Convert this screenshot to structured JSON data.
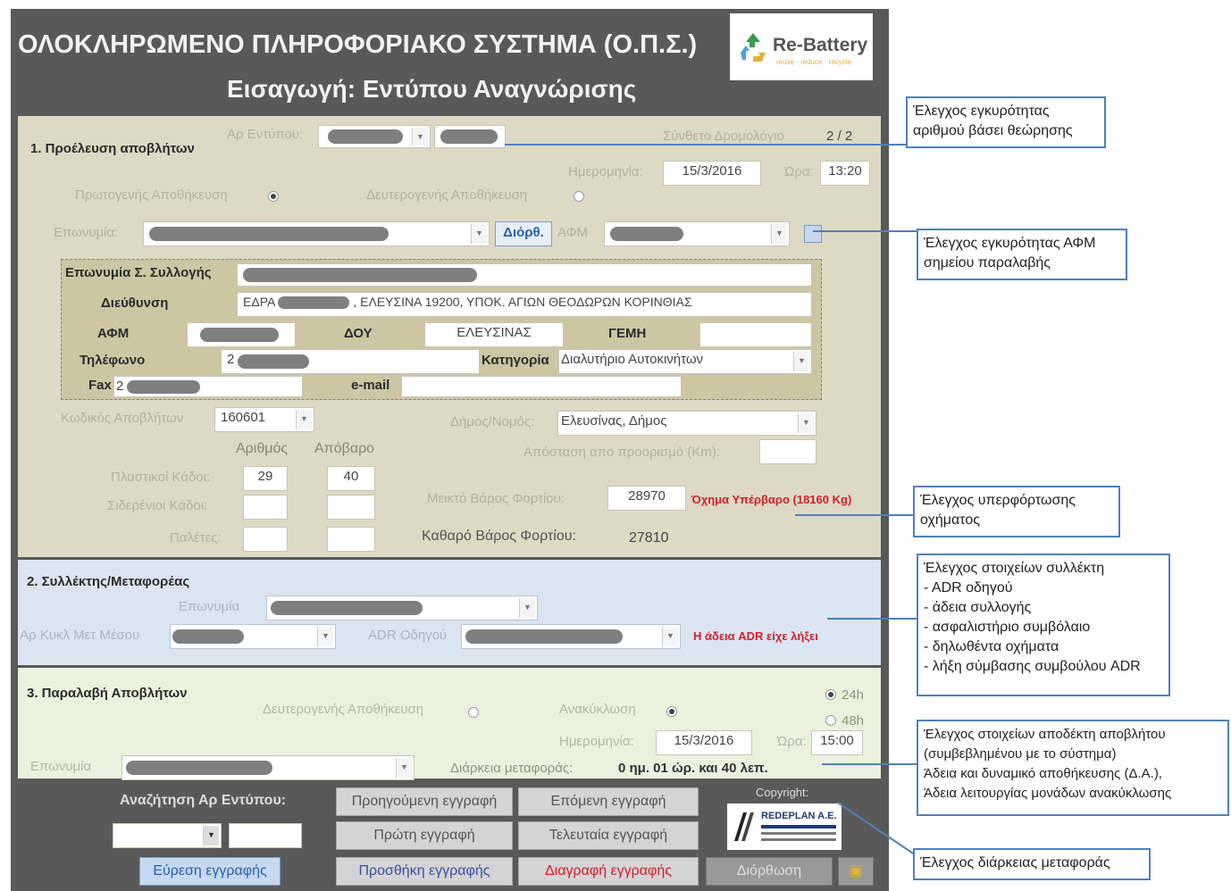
{
  "header": {
    "title": "ΟΛΟΚΛΗΡΩΜΕΝΟ ΠΛΗΡΟΦΟΡΙΑΚΟ ΣΥΣΤΗΜΑ (Ο.Π.Σ.)",
    "subtitle": "Εισαγωγή: Εντύπου Αναγνώρισης",
    "logo_text": "Re-Battery",
    "logo_tagline": "reuse · reduce · recycle"
  },
  "section1": {
    "title": "1. Προέλευση αποβλήτων",
    "form_no_label": "Αρ Εντύπου:",
    "composite_route_label": "Σύνθετο Δρομολόγιο",
    "composite_route_value": "2 / 2",
    "date_label": "Ημερομηνία:",
    "date_value": "15/3/2016",
    "time_label": "Ώρα:",
    "time_value": "13:20",
    "primary_storage_label": "Πρωτογενής Αποθήκευση",
    "secondary_storage_label": "Δευτερογενής Αποθήκευση",
    "name_label": "Επωνυμία:",
    "edit_button": "Διόρθ.",
    "afm_label": "ΑΦΜ",
    "collection_name_label": "Επωνυμία Σ. Συλλογής",
    "address_label": "Διεύθυνση",
    "address_prefix": "ΕΔΡΑ",
    "address_rest": ", ΕΛΕΥΣΙΝΑ 19200, ΥΠΟΚ. ΑΓΙΩΝ ΘΕΟΔΩΡΩΝ ΚΟΡΙΝΘΙΑΣ",
    "afm2_label": "ΑΦΜ",
    "doy_label": "ΔΟΥ",
    "doy_value": "ΕΛΕΥΣΙΝΑΣ",
    "gemi_label": "ΓΕΜΗ",
    "phone_label": "Τηλέφωνο",
    "phone_prefix": "2",
    "category_label": "Κατηγορία",
    "category_value": "Διαλυτήριο Αυτοκινήτων",
    "fax_label": "Fax",
    "fax_prefix": "2",
    "email_label": "e-mail",
    "waste_code_label": "Κωδικός Αποβλήτων",
    "waste_code_value": "160601",
    "municipality_label": "Δήμος/Νομός:",
    "municipality_value": "Ελευσίνας, Δήμος",
    "count_header": "Αριθμός",
    "tare_header": "Απόβαρο",
    "distance_label": "Απόσταση απο προορισμό (Km):",
    "plastic_bins_label": "Πλαστικοί Κάδοι:",
    "plastic_count": "29",
    "plastic_tare": "40",
    "iron_bins_label": "Σιδερένιοι Κάδοι:",
    "pallets_label": "Παλέτες:",
    "gross_weight_label": "Μεικτό Βάρος Φορτίου:",
    "gross_weight_value": "28970",
    "overweight_warning": "Όχημα Υπέρβαρο (18160 Kg)",
    "net_weight_label": "Καθαρό Βάρος Φορτίου:",
    "net_weight_value": "27810"
  },
  "section2": {
    "title": "2. Συλλέκτης/Μεταφορέας",
    "name_label": "Επωνυμία",
    "vehicle_label": "Αρ Κυκλ Μετ Μέσου",
    "adr_label": "ADR Οδηγού",
    "adr_warning": "Η άδεια ADR είχε λήξει"
  },
  "section3": {
    "title": "3. Παραλαβή Αποβλήτων",
    "secondary_storage_label": "Δευτερογενής Αποθήκευση",
    "recycling_label": "Ανακύκλωση",
    "opt24": "24h",
    "opt48": "48h",
    "date_label": "Ημερομηνία:",
    "date_value": "15/3/2016",
    "time_label": "Ώρα:",
    "time_value": "15:00",
    "name_label": "Επωνυμία",
    "duration_label": "Διάρκεια μεταφοράς:",
    "duration_value": "0 ημ. 01 ώρ. και 40 λεπ."
  },
  "footer": {
    "search_label": "Αναζήτηση Αρ Εντύπου:",
    "find_button": "Εύρεση εγγραφής",
    "prev_button": "Προηγούμενη εγγραφή",
    "next_button": "Επόμενη εγγραφή",
    "first_button": "Πρώτη εγγραφή",
    "last_button": "Τελευταία εγγραφή",
    "add_button": "Προσθήκη εγγραφής",
    "delete_button": "Διαγραφή εγγραφής",
    "edit_button": "Διόρθωση",
    "copyright_label": "Copyright:",
    "company_logo_text": "REDEPLAN A.E."
  },
  "annotations": {
    "a1": [
      "Έλεγχος εγκυρότητας",
      "αριθμού βάσει θεώρησης"
    ],
    "a2": [
      "Έλεγχος εγκυρότητας ΑΦΜ",
      "σημείου παραλαβής"
    ],
    "a3": [
      "Έλεγχος υπερφόρτωσης",
      "οχήματος"
    ],
    "a4": [
      "Έλεγχος στοιχείων συλλέκτη",
      "- ADR οδηγού",
      "- άδεια συλλογής",
      "- ασφαλιστήριο συμβόλαιο",
      "- δηλωθέντα οχήματα",
      "- λήξη σύμβασης συμβούλου ADR"
    ],
    "a5": [
      "Έλεγχος στοιχείων αποδέκτη αποβλήτου",
      "(συμβεβλημένου με το σύστημα)",
      "Άδεια και δυναμικό αποθήκευσης (Δ.Α.),",
      "Άδεια λειτουργίας μονάδων ανακύκλωσης"
    ],
    "a6": [
      "Έλεγχος διάρκειας μεταφοράς"
    ]
  },
  "colors": {
    "frame": "#595959",
    "section1_bg": "#ddd9c4",
    "section2_bg": "#dbe5f1",
    "section3_bg": "#ebf1de",
    "warning_red": "#d0202a",
    "annotation_border": "#4f81bd"
  }
}
